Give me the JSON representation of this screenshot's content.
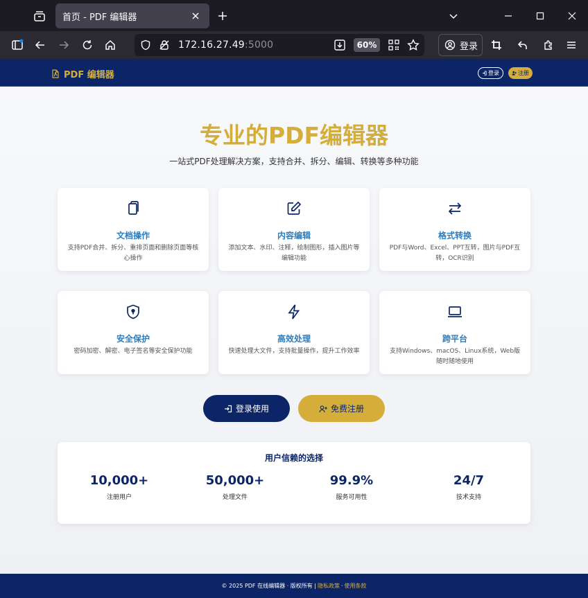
{
  "browser": {
    "tab_title": "首页 - PDF 编辑器",
    "url_host": "172.16.27.49",
    "url_port": ":5000",
    "zoom": "60%",
    "account_label": "登录"
  },
  "site": {
    "brand": "PDF 编辑器",
    "header_login": "登录",
    "header_register": "注册",
    "hero_title": "专业的PDF编辑器",
    "hero_subtitle": "一站式PDF处理解决方案，支持合并、拆分、编辑、转换等多种功能",
    "features": [
      {
        "title": "文档操作",
        "desc": "支持PDF合并、拆分、重排页面和删除页面等核心操作",
        "icon": "files-icon"
      },
      {
        "title": "内容编辑",
        "desc": "添加文本、水印、注释，绘制图形，插入图片等编辑功能",
        "icon": "edit-icon"
      },
      {
        "title": "格式转换",
        "desc": "PDF与Word、Excel、PPT互转，图片与PDF互转，OCR识别",
        "icon": "arrows-exchange-icon"
      },
      {
        "title": "安全保护",
        "desc": "密码加密、解密、电子签名等安全保护功能",
        "icon": "shield-lock-icon"
      },
      {
        "title": "高效处理",
        "desc": "快速处理大文件，支持批量操作，提升工作效率",
        "icon": "lightning-icon"
      },
      {
        "title": "跨平台",
        "desc": "支持Windows、macOS、Linux系统，Web版随时随地使用",
        "icon": "laptop-icon"
      }
    ],
    "cta_login": "登录使用",
    "cta_register": "免费注册",
    "stats_title": "用户信赖的选择",
    "stats": [
      {
        "value": "10,000+",
        "label": "注册用户"
      },
      {
        "value": "50,000+",
        "label": "处理文件"
      },
      {
        "value": "99.9%",
        "label": "服务可用性"
      },
      {
        "value": "24/7",
        "label": "技术支持"
      }
    ],
    "footer_copyright": "© 2025 PDF 在线编辑器 · 版权所有 |",
    "footer_privacy": "隐私政策",
    "footer_sep": "·",
    "footer_terms": "使用条款"
  },
  "colors": {
    "navy": "#0c2566",
    "gold": "#d5ad3a",
    "feature_title_blue": "#2c7dbf"
  }
}
